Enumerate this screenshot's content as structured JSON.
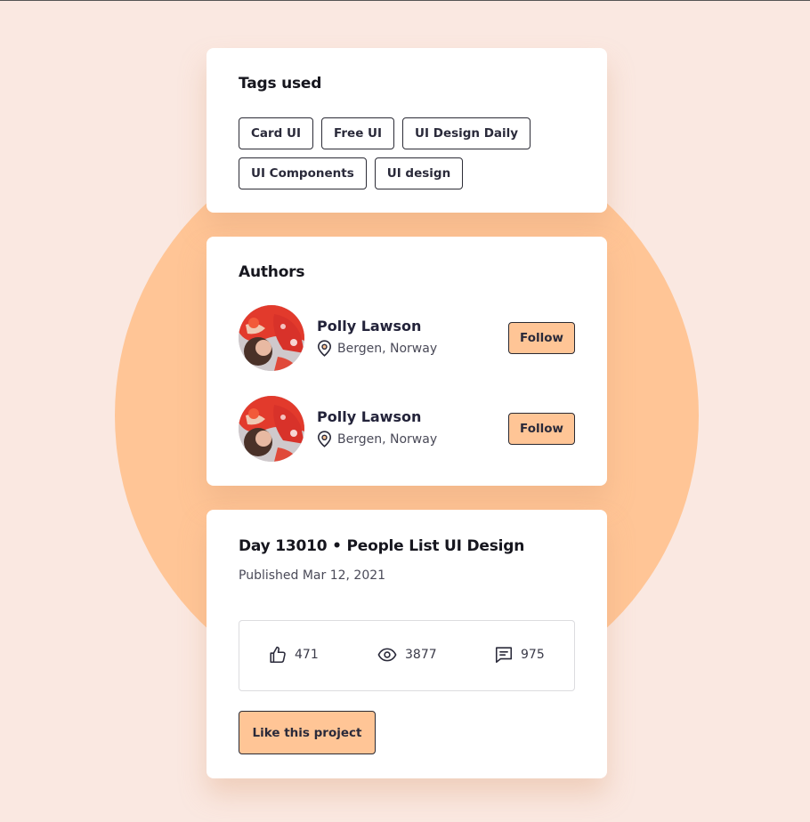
{
  "colors": {
    "page_bg": "#fae8e1",
    "accent": "#ffc596",
    "card_bg": "#ffffff",
    "text": "#16161e"
  },
  "tags_card": {
    "title": "Tags used",
    "tags": [
      "Card UI",
      "Free UI",
      "UI Design Daily",
      "UI Components",
      "UI design"
    ]
  },
  "authors_card": {
    "title": "Authors",
    "authors": [
      {
        "name": "Polly Lawson",
        "location": "Bergen, Norway",
        "follow_label": "Follow",
        "location_icon": "map-pin-icon"
      },
      {
        "name": "Polly Lawson",
        "location": "Bergen, Norway",
        "follow_label": "Follow",
        "location_icon": "map-pin-icon"
      }
    ]
  },
  "project_card": {
    "title": "Day 13010 • People List UI Design",
    "published": "Published Mar 12, 2021",
    "stats": {
      "likes": "471",
      "views": "3877",
      "comments": "975"
    },
    "like_button_label": "Like this project"
  }
}
